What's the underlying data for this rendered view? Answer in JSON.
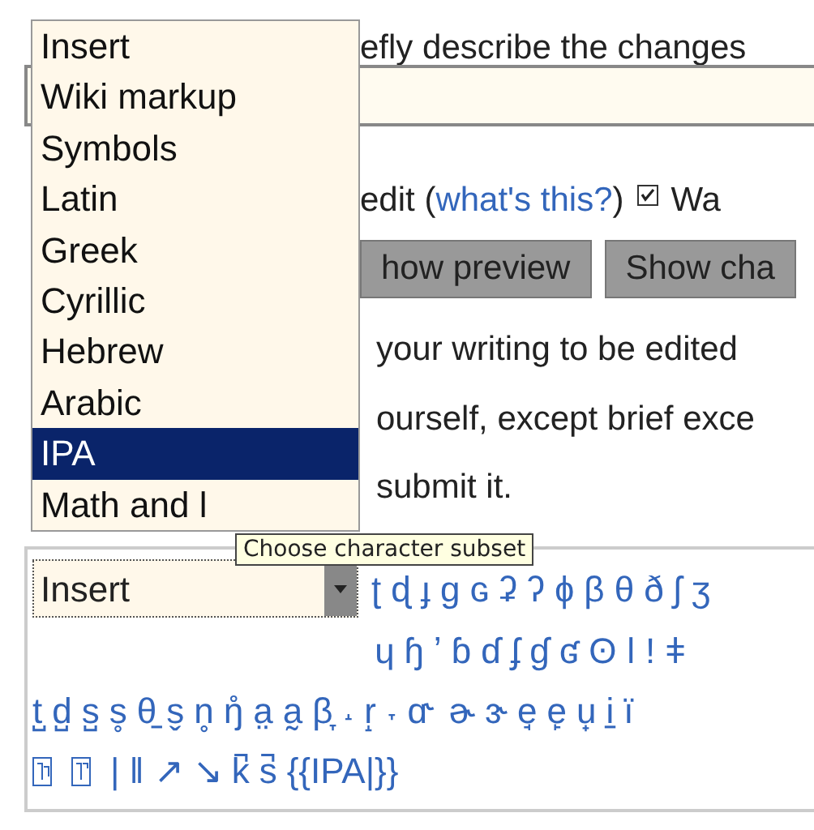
{
  "page": {
    "summary_label": "efly describe the changes",
    "minor_edit": {
      "label": "edit (",
      "link": "what's this?",
      "after": ")"
    },
    "watch": {
      "checked": true,
      "label": "Wa"
    },
    "buttons": [
      "how preview",
      "Show cha"
    ],
    "notice_lines": [
      "your writing to be edited",
      "ourself, except brief exce",
      "submit it."
    ]
  },
  "dropdown": {
    "items": [
      {
        "label": "Insert",
        "selected": false
      },
      {
        "label": "Wiki markup",
        "selected": false
      },
      {
        "label": "Symbols",
        "selected": false
      },
      {
        "label": "Latin",
        "selected": false
      },
      {
        "label": "Greek",
        "selected": false
      },
      {
        "label": "Cyrillic",
        "selected": false
      },
      {
        "label": "Hebrew",
        "selected": false
      },
      {
        "label": "Arabic",
        "selected": false
      },
      {
        "label": "IPA",
        "selected": true
      },
      {
        "label": "Math and l",
        "selected": false
      }
    ]
  },
  "tooltip": "Choose character subset",
  "edittools": {
    "select_value": "Insert",
    "lines": [
      {
        "chars": [
          "ʈ",
          "ɖ",
          "ɟ",
          "ɡ",
          "ɢ",
          "ʡ",
          "ʔ",
          "ɸ",
          "β",
          "θ",
          "ð",
          "ʃ",
          "ʒ"
        ]
      },
      {
        "chars": [
          "ɥ",
          "ɧ",
          "ʼ",
          "ɓ",
          "ɗ",
          "ʄ",
          "ɠ",
          "ʛ",
          "ʘ",
          "ǀ",
          "ǃ",
          "ǂ"
        ]
      },
      {
        "chars": [
          "t̺",
          "d̺",
          "s̺",
          "s̥",
          "θ̠",
          "s̬",
          "n̥",
          "ŋ̊",
          "a̤",
          "a̰",
          "β̞",
          "˔",
          "r̝",
          "˕",
          "ɑ˞",
          "ɚ",
          "ɝ",
          "e̘",
          "e̙",
          "u̟",
          "i̠",
          "ï"
        ]
      },
      {
        "chars": [
          "|",
          "‖",
          "↗",
          "↘",
          "k̚",
          "s̚",
          "{{IPA|}}"
        ]
      }
    ]
  }
}
